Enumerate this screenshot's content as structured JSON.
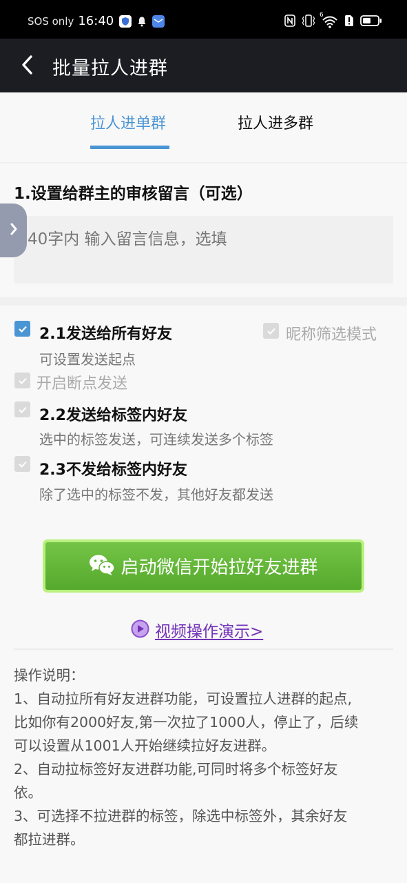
{
  "status_bar": {
    "carrier": "SOS only",
    "time": "16:40",
    "left_icons": [
      "shield-icon",
      "bell-icon",
      "mail-app-icon"
    ],
    "right_icons": [
      "nfc-icon",
      "vibrate-icon",
      "wifi-icon",
      "alert-sim-icon",
      "battery-icon"
    ],
    "wifi_label": "6"
  },
  "app_bar": {
    "back_icon": "chevron-left-icon",
    "title": "批量拉人进群"
  },
  "tabs": [
    {
      "label": "拉人进单群",
      "active": true
    },
    {
      "label": "拉人进多群",
      "active": false
    }
  ],
  "section1": {
    "title": "1.设置给群主的审核留言（可选）",
    "input_value": "",
    "input_placeholder": "40字内 输入留言信息，选填"
  },
  "side_handle": {
    "icon": "chevron-right-icon"
  },
  "options": {
    "send_all": {
      "title": "2.1发送给所有好友",
      "desc": "可设置发送起点",
      "checked": true
    },
    "nickname_filter": {
      "label": "昵称筛选模式",
      "checked": true,
      "enabled": false
    },
    "resume_send": {
      "label": "开启断点发送",
      "checked": true,
      "enabled": false
    },
    "send_tags": {
      "title": "2.2发送给标签内好友",
      "desc": "选中的标签发送，可连续发送多个标签",
      "checked": true,
      "enabled": false
    },
    "exclude_tags": {
      "title": "2.3不发给标签内好友",
      "desc": "除了选中的标签不发，其他好友都发送",
      "checked": true,
      "enabled": false
    }
  },
  "start_button": {
    "icon": "wechat-icon",
    "label": "启动微信开始拉好友进群"
  },
  "video_link": {
    "icon": "play-circle-icon",
    "label": "视频操作演示>"
  },
  "help": {
    "title": "操作说明：",
    "lines": [
      "1、自动拉所有好友进群功能，可设置拉人进群的起点,",
      "比如你有2000好友,第一次拉了1000人，停止了，后续",
      "可以设置从1001人开始继续拉好友进群。",
      "2、自动拉标签好友进群功能,可同时将多个标签好友",
      "依。",
      "3、可选择不拉进群的标签，除选中标签外，其余好友",
      "都拉进群。"
    ]
  },
  "colors": {
    "accent_blue": "#4a95d4",
    "app_bar_bg": "#1b1d22",
    "button_green": "#5fb534",
    "button_border": "#b9f07e",
    "link_purple": "#7232b8"
  }
}
